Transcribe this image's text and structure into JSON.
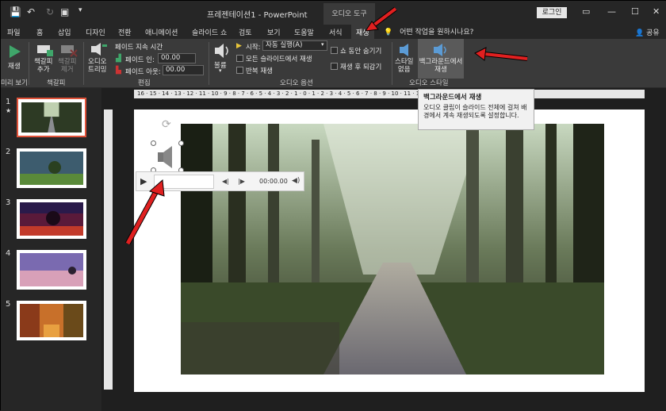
{
  "app": {
    "title": "프레젠테이션1  -  PowerPoint",
    "tool_group": "오디오 도구",
    "login": "로그인",
    "share": "공유",
    "tell_me": "어떤 작업을 원하시나요?"
  },
  "tabs": [
    "파일",
    "홈",
    "삽입",
    "디자인",
    "전환",
    "애니메이션",
    "슬라이드 쇼",
    "검토",
    "보기",
    "도움말",
    "서식",
    "재생"
  ],
  "active_tab": "재생",
  "ribbon": {
    "play_label": "재생",
    "add_bookmark": "책갈피\n추가",
    "remove_bookmark": "책갈피\n제거",
    "bookmarks_group": "책갈피",
    "preview_group": "미리 보기",
    "trim_audio": "오디오\n트리밍",
    "fade_duration": "페이드 지속 시간",
    "fade_in_label": "페이드 인:",
    "fade_in_value": "00.00",
    "fade_out_label": "페이드 아웃:",
    "fade_out_value": "00.00",
    "editing_group": "편집",
    "volume_label": "볼륨",
    "start_label": "시작:",
    "start_value": "자동 실행(A)",
    "play_across_slides": "모든 슬라이드에서 재생",
    "loop": "반복 재생",
    "hide_during_show": "쇼 동안 숨기기",
    "rewind_after": "재생 후 되감기",
    "audio_options_group": "오디오 옵션",
    "no_style": "스타일\n없음",
    "play_in_background": "백그라운드에서\n재생",
    "audio_styles_group": "오디오 스타일"
  },
  "tooltip": {
    "title": "백그라운드에서 재생",
    "description": "오디오 클립이 슬라이드 전체에 걸쳐 배경에서 계속 재생되도록 설정합니다."
  },
  "player": {
    "time": "00:00.00"
  },
  "slides": [
    {
      "number": "1",
      "marker": "★",
      "scene": "forest"
    },
    {
      "number": "2",
      "scene": "tree-sky"
    },
    {
      "number": "3",
      "scene": "red-tree"
    },
    {
      "number": "4",
      "scene": "lake"
    },
    {
      "number": "5",
      "scene": "autumn"
    }
  ],
  "hruler_ticks": "16 · 15 · 14 · 13 · 12 · 11 · 10 · 9 · 8 · 7 · 6 · 5 · 4 · 3 · 2 · 1 · 0 · 1 · 2 · 3 · 4 · 5 · 6 · 7 · 8 · 9 · 10 · 11 · 12 · 13 · 14 · 15 · 16",
  "colors": {
    "accent_red": "#e0533a",
    "ribbon_bg": "#3a3a3a",
    "titlebar_bg": "#262626"
  }
}
